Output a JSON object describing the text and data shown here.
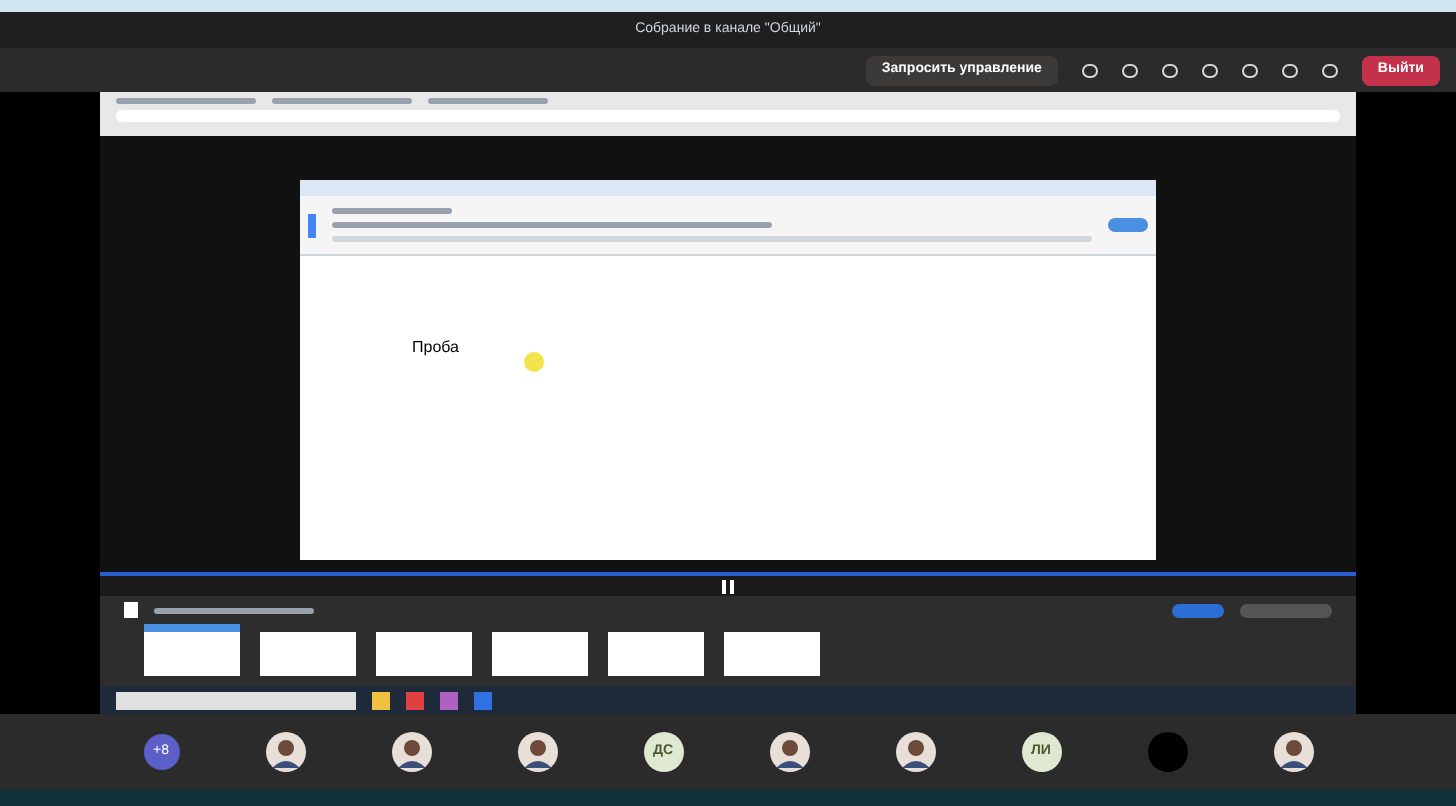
{
  "window": {
    "title": "Собрание в канале \"Общий\""
  },
  "toolbar": {
    "request_control": "Запросить управление",
    "leave": "Выйти"
  },
  "document": {
    "text": "Проба"
  },
  "thumbnails": [
    {
      "selected": true
    },
    {
      "selected": false
    },
    {
      "selected": false
    },
    {
      "selected": false
    },
    {
      "selected": false
    },
    {
      "selected": false
    }
  ],
  "participants": [
    {
      "kind": "count",
      "label": "+8"
    },
    {
      "kind": "photo"
    },
    {
      "kind": "photo"
    },
    {
      "kind": "photo"
    },
    {
      "kind": "initials",
      "label": "ДС"
    },
    {
      "kind": "photo"
    },
    {
      "kind": "photo"
    },
    {
      "kind": "initials",
      "label": "ЛИ"
    },
    {
      "kind": "blank"
    },
    {
      "kind": "photo"
    }
  ]
}
